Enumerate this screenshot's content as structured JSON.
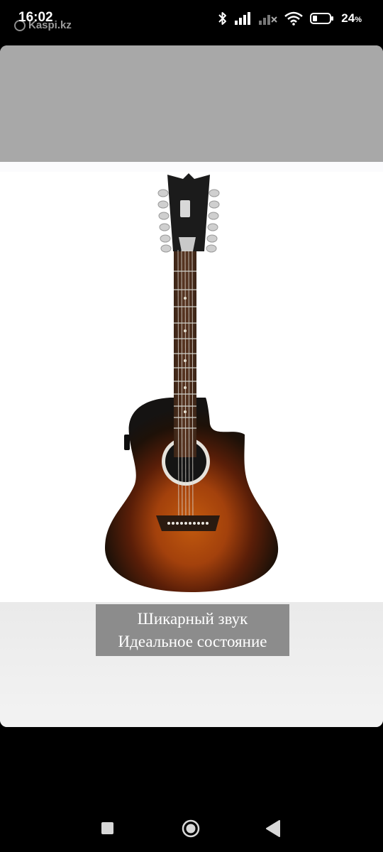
{
  "status_bar": {
    "time": "16:02",
    "watermark": "Kaspi.kz",
    "battery_level": "24",
    "battery_unit": "%",
    "icons": [
      "bluetooth-icon",
      "signal-icon",
      "signal-off-icon",
      "wifi-icon",
      "battery-icon"
    ]
  },
  "photo": {
    "subject": "guitar-image",
    "caption_lines": [
      "Шикарный звук",
      "Идеальное состояние"
    ],
    "colors": {
      "top_band": "#a8a8a8",
      "caption_bg": "#8c8c8c"
    }
  },
  "nav_bar": {
    "buttons": [
      "recents-button",
      "home-button",
      "back-button"
    ]
  }
}
